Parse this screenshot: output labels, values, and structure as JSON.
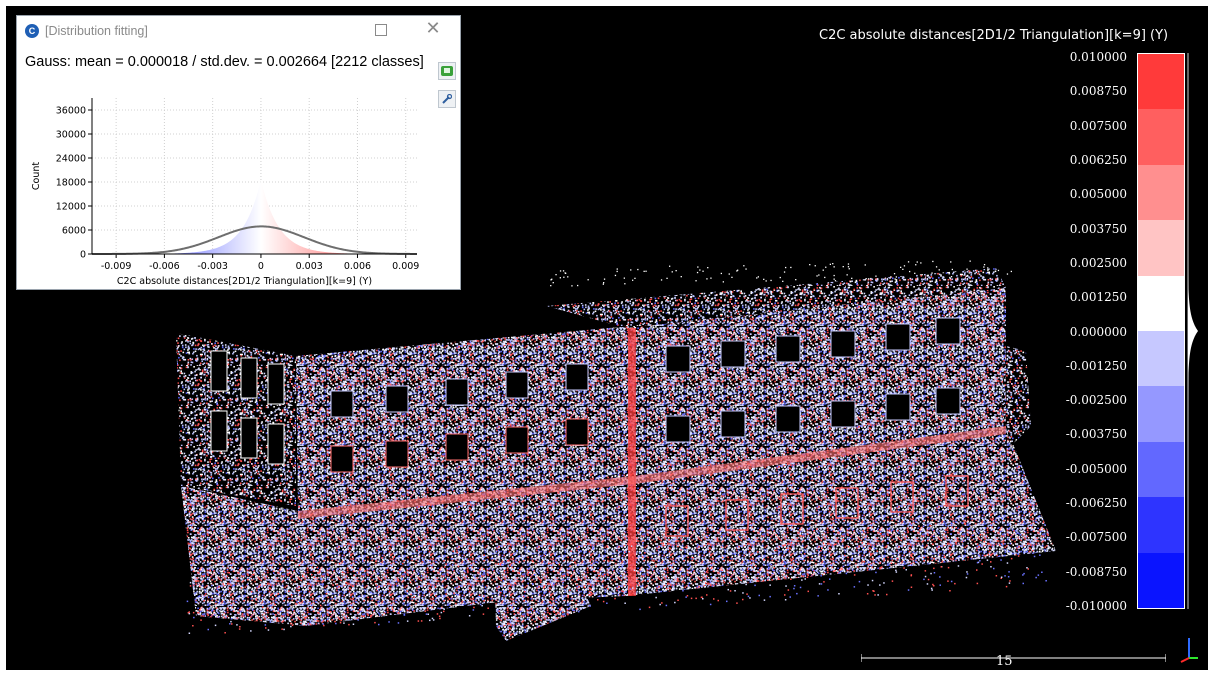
{
  "dialog": {
    "title": "[Distribution fitting]",
    "gauss_summary": "Gauss: mean = 0.000018 / std.dev. = 0.002664 [2212 classes]",
    "maximize_glyph": "□",
    "close_glyph": "✕",
    "icons": [
      "cloudcompare-logo-icon",
      "maximize-icon",
      "close-icon",
      "export-csv-icon",
      "settings-icon"
    ]
  },
  "chart_data": {
    "type": "area",
    "xlabel": "C2C absolute distances[2D1/2 Triangulation][k=9] (Y)",
    "ylabel": "Count",
    "x_ticks": [
      "-0.009",
      "-0.006",
      "-0.003",
      "0",
      "0.003",
      "0.006",
      "0.009"
    ],
    "y_ticks": [
      "0",
      "6000",
      "12000",
      "18000",
      "24000",
      "30000",
      "36000"
    ],
    "xlim": [
      -0.0105,
      0.0097
    ],
    "ylim": [
      0,
      39000
    ],
    "grid": true,
    "series": [
      {
        "kind": "histogram",
        "peak": 18500,
        "center": 0.0,
        "spread": 0.0011
      },
      {
        "kind": "gauss-fit",
        "mean": 1.8e-05,
        "std": 0.002664,
        "peak": 6900
      }
    ]
  },
  "colors": {
    "pos_max": "#ff2a2a",
    "neg_max": "#0a14ff",
    "zero": "#ffffff",
    "fit_curve": "#6e6e6e",
    "background": "#000000"
  },
  "scale": {
    "title": "C2C absolute distances[2D1/2 Triangulation][k=9] (Y)",
    "ticks": [
      "0.010000",
      "0.008750",
      "0.007500",
      "0.006250",
      "0.005000",
      "0.003750",
      "0.002500",
      "0.001250",
      "0.000000",
      "-0.001250",
      "-0.002500",
      "-0.003750",
      "-0.005000",
      "-0.006250",
      "-0.007500",
      "-0.008750",
      "-0.010000"
    ],
    "bands": [
      "#ff3a3a",
      "#ff5f5f",
      "#ff8f8f",
      "#ffc4c4",
      "#ffffff",
      "#c6c8ff",
      "#9598ff",
      "#6268ff",
      "#2e34ff",
      "#0a14ff"
    ]
  },
  "scalebar": {
    "label": "15"
  }
}
